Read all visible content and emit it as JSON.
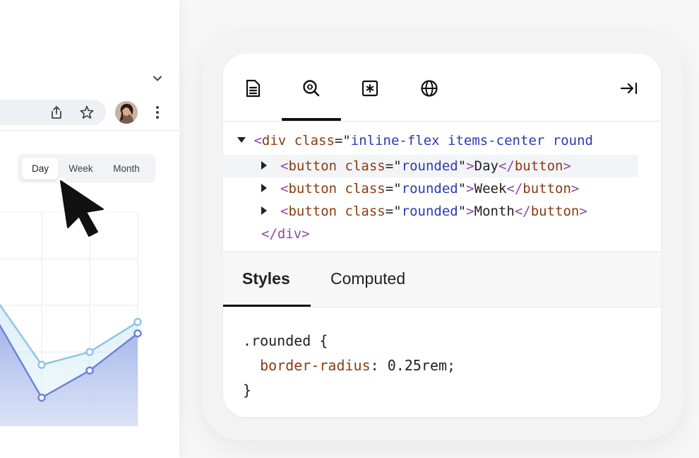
{
  "browser": {
    "segmented_control": {
      "options": [
        "Day",
        "Week",
        "Month"
      ],
      "selected": "Day"
    },
    "icons": [
      "chevron-down-icon",
      "share-icon",
      "star-icon",
      "avatar",
      "more-vert-icon",
      "cursor-pointer-icon"
    ]
  },
  "chart_data": {
    "type": "area",
    "title": "",
    "xlabel": "",
    "ylabel": "",
    "grid": true,
    "legend": "none",
    "series": [
      {
        "color": "#8ec5e6",
        "values": [
          92,
          43,
          52,
          73
        ]
      },
      {
        "color": "#6b85d8",
        "values": [
          79,
          20,
          39,
          65
        ]
      }
    ],
    "ylim": [
      0,
      150
    ]
  },
  "devtools": {
    "tabs": [
      {
        "icon": "document-icon",
        "active": false
      },
      {
        "icon": "inspect-code-icon",
        "active": true
      },
      {
        "icon": "asterisk-box-icon",
        "active": false
      },
      {
        "icon": "globe-icon",
        "active": false
      }
    ],
    "collapse_icon": "collapse-right-icon",
    "elements": {
      "root_open": "<div class=\"inline-flex items-center round",
      "root_tag": "div",
      "root_attr": "class",
      "root_value": "inline-flex items-center round",
      "children": [
        {
          "tag": "button",
          "attr": "class",
          "value": "rounded",
          "text": "Day"
        },
        {
          "tag": "button",
          "attr": "class",
          "value": "rounded",
          "text": "Week"
        },
        {
          "tag": "button",
          "attr": "class",
          "value": "rounded",
          "text": "Month"
        }
      ],
      "root_close": "</div>"
    },
    "subtabs": [
      "Styles",
      "Computed"
    ],
    "active_subtab": "Styles",
    "styles": {
      "selector": ".rounded {",
      "property": "border-radius",
      "value": "0.25rem;",
      "closing": "}"
    }
  },
  "colors": {
    "accent_purple": "#8a4ba0",
    "attr_brown": "#8a3c10",
    "value_blue": "#2b3bb4"
  }
}
